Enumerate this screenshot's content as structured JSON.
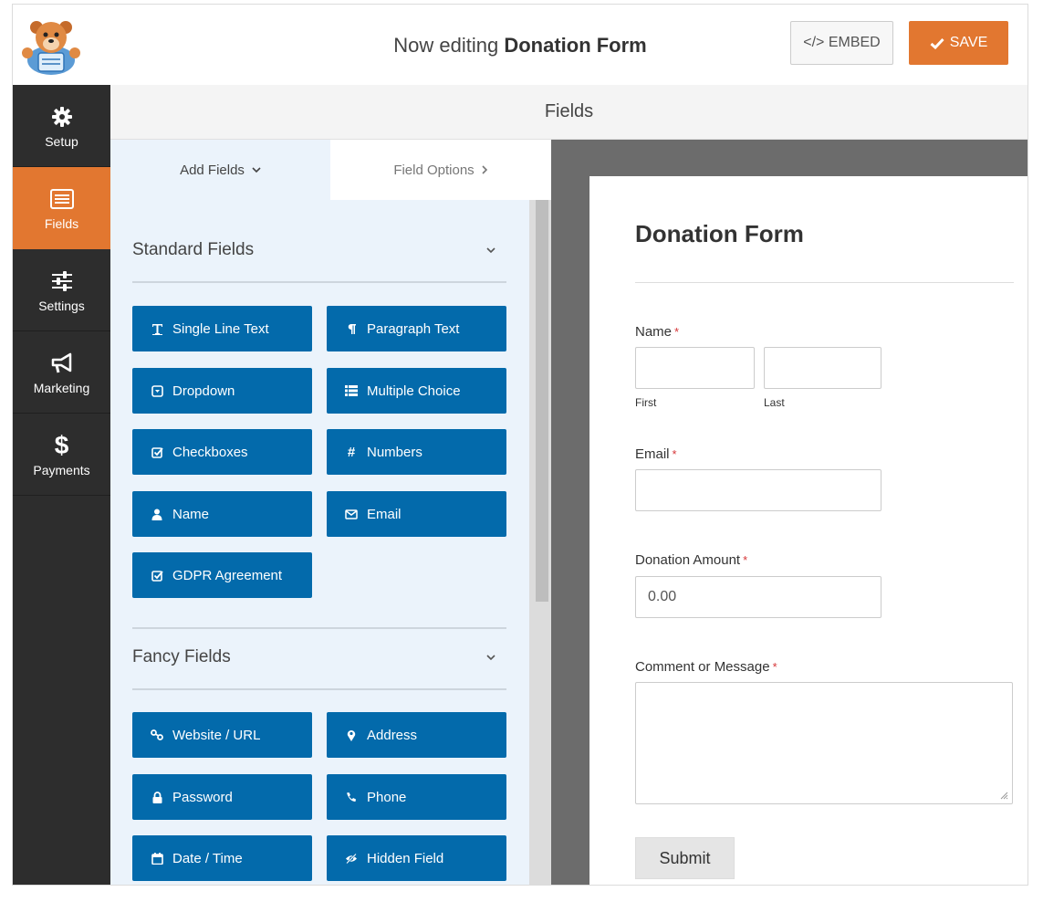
{
  "header": {
    "editing_prefix": "Now editing",
    "form_name": "Donation Form",
    "embed_label": "</> EMBED",
    "save_label": "SAVE"
  },
  "sidebar": {
    "items": [
      {
        "label": "Setup",
        "icon": "gear-icon"
      },
      {
        "label": "Fields",
        "icon": "fields-list-icon",
        "active": true
      },
      {
        "label": "Settings",
        "icon": "sliders-icon"
      },
      {
        "label": "Marketing",
        "icon": "megaphone-icon"
      },
      {
        "label": "Payments",
        "icon": "dollar-icon"
      }
    ]
  },
  "fields_header": "Fields",
  "panel": {
    "tabs": {
      "add_fields": "Add Fields",
      "field_options": "Field Options"
    },
    "standard": {
      "title": "Standard Fields",
      "buttons": [
        {
          "label": "Single Line Text",
          "icon": "text-icon"
        },
        {
          "label": "Paragraph Text",
          "icon": "paragraph-icon"
        },
        {
          "label": "Dropdown",
          "icon": "dropdown-icon"
        },
        {
          "label": "Multiple Choice",
          "icon": "list-icon"
        },
        {
          "label": "Checkboxes",
          "icon": "checkbox-icon"
        },
        {
          "label": "Numbers",
          "icon": "hash-icon"
        },
        {
          "label": "Name",
          "icon": "user-icon"
        },
        {
          "label": "Email",
          "icon": "envelope-icon"
        },
        {
          "label": "GDPR Agreement",
          "icon": "checkbox-icon"
        }
      ]
    },
    "fancy": {
      "title": "Fancy Fields",
      "buttons": [
        {
          "label": "Website / URL",
          "icon": "link-icon"
        },
        {
          "label": "Address",
          "icon": "map-marker-icon"
        },
        {
          "label": "Password",
          "icon": "lock-icon"
        },
        {
          "label": "Phone",
          "icon": "phone-icon"
        },
        {
          "label": "Date / Time",
          "icon": "calendar-icon"
        },
        {
          "label": "Hidden Field",
          "icon": "eye-slash-icon"
        }
      ]
    }
  },
  "preview": {
    "title": "Donation Form",
    "name_label": "Name",
    "first_sub": "First",
    "last_sub": "Last",
    "email_label": "Email",
    "amount_label": "Donation Amount",
    "amount_value": "0.00",
    "comment_label": "Comment or Message",
    "required_mark": "*",
    "submit_label": "Submit"
  },
  "colors": {
    "accent": "#e27730",
    "field_button": "#036aab",
    "sidebar": "#2d2d2d",
    "panel_bg": "#ebf3fb",
    "preview_bg": "#6c6c6c"
  }
}
